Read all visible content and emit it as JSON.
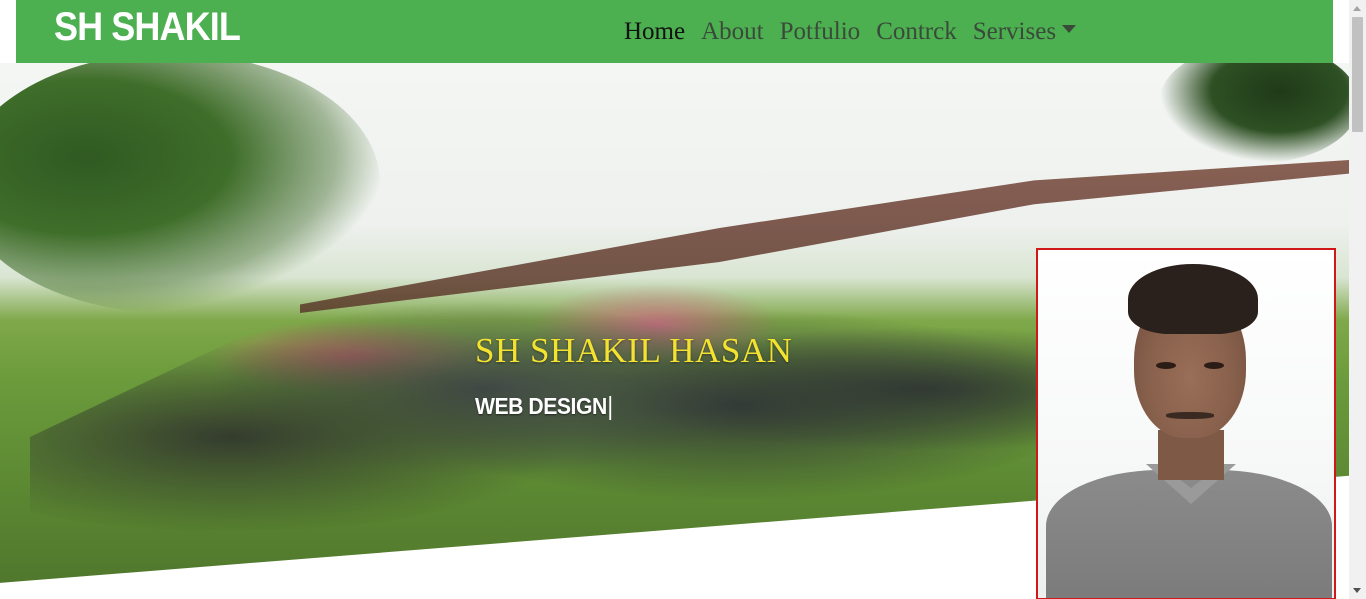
{
  "navbar": {
    "brand": "SH SHAKIL",
    "links": [
      {
        "label": "Home",
        "active": true
      },
      {
        "label": "About"
      },
      {
        "label": "Potfulio"
      },
      {
        "label": "Contrck"
      },
      {
        "label": "Servises",
        "dropdown": true
      }
    ],
    "bg_color": "#4caf50"
  },
  "hero": {
    "title": "SH SHAKIL HASAN",
    "subtitle": "WEB DESIGN",
    "title_color": "#f4e231",
    "subtitle_color": "#ffffff",
    "background_image": "group-photo-outdoors",
    "profile_image": "profile-photo",
    "profile_border_color": "#d01818"
  },
  "icons": {
    "dropdown": "caret-down-icon",
    "scroll_up": "scroll-up-arrow-icon",
    "scroll_down": "scroll-down-arrow-icon"
  }
}
